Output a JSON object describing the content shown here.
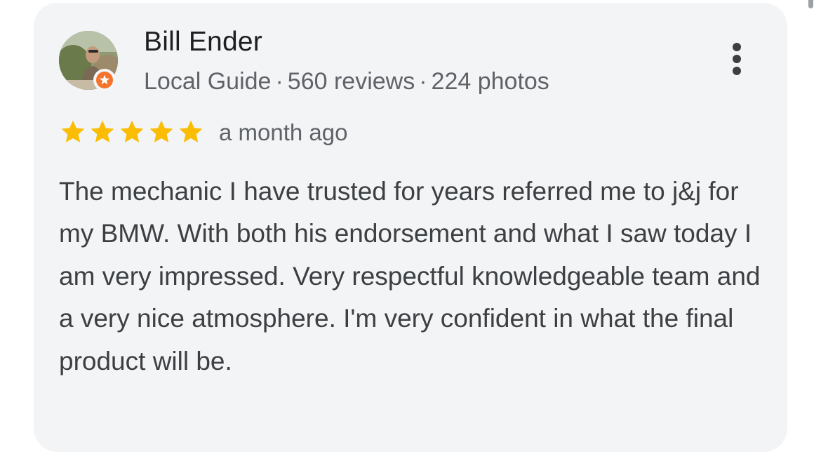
{
  "review": {
    "author": "Bill Ender",
    "author_meta": {
      "badge": "Local Guide",
      "reviews": "560 reviews",
      "photos": "224 photos",
      "separator": "·"
    },
    "rating": 5,
    "rating_max": 5,
    "time_ago": "a month ago",
    "text": "The mechanic I have trusted for years referred me to j&j for my BMW. With both his endorsement and what I saw today I am very impressed. Very respectful knowledgeable team and a very nice atmosphere. I'm very confident in what the final product will be."
  },
  "icons": {
    "avatar": "user-photo",
    "badge": "local-guide-star-badge",
    "menu": "more-vertical-icon",
    "star": "star-icon"
  },
  "colors": {
    "card_background": "#f3f4f6",
    "star": "#fbbc04",
    "badge": "#f4742b",
    "name_text": "#1f1f1f",
    "meta_text": "#5f6368",
    "body_text": "#3c4043"
  }
}
